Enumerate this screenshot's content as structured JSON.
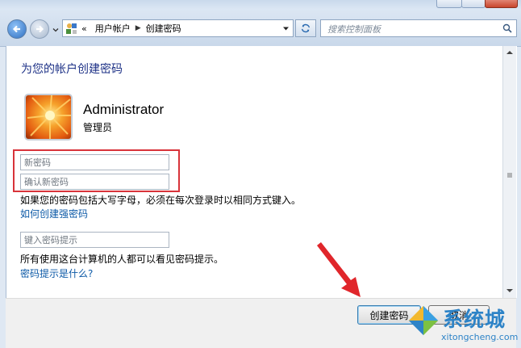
{
  "nav": {
    "breadcrumb_overflow": "«",
    "breadcrumb": [
      "用户帐户",
      "创建密码"
    ],
    "search_placeholder": "搜索控制面板"
  },
  "page": {
    "heading": "为您的帐户创建密码",
    "user_name": "Administrator",
    "user_role": "管理员",
    "new_password_placeholder": "新密码",
    "confirm_password_placeholder": "确认新密码",
    "case_note": "如果您的密码包括大写字母，必须在每次登录时以相同方式键入。",
    "strong_password_link": "如何创建强密码",
    "hint_placeholder": "键入密码提示",
    "hint_note": "所有使用这台计算机的人都可以看见密码提示。",
    "hint_link": "密码提示是什么?"
  },
  "buttons": {
    "create": "创建密码",
    "cancel": "取消"
  },
  "watermark": {
    "brand": "系统城",
    "url": "xitongcheng.com"
  },
  "colors": {
    "heading": "#1e3287",
    "link": "#0d5aa7",
    "highlight_box": "#d8333a",
    "annotation_arrow": "#e0262b"
  }
}
